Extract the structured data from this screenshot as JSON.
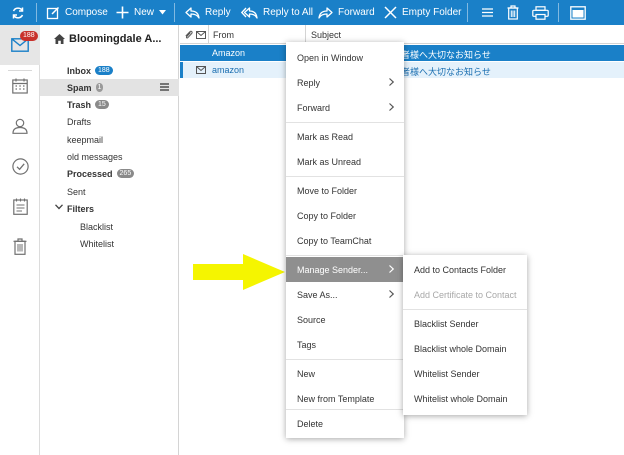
{
  "toolbar": {
    "compose": "Compose",
    "new": "New",
    "reply": "Reply",
    "reply_all": "Reply to All",
    "forward": "Forward",
    "empty_folder": "Empty Folder"
  },
  "rail": {
    "mail_badge": "188"
  },
  "folders": {
    "account": "Bloomingdale A...",
    "items": [
      {
        "name": "Inbox",
        "badge": "188"
      },
      {
        "name": "Spam",
        "badge": "1"
      },
      {
        "name": "Trash",
        "badge": "15"
      },
      {
        "name": "Drafts"
      },
      {
        "name": "keepmail"
      },
      {
        "name": "old messages"
      },
      {
        "name": "Processed",
        "badge": "265"
      },
      {
        "name": "Sent"
      },
      {
        "name": "Filters"
      },
      {
        "name": "Blacklist"
      },
      {
        "name": "Whitelist"
      }
    ]
  },
  "list": {
    "columns": {
      "from": "From",
      "subject": "Subject"
    },
    "rows": [
      {
        "from": "Amazon",
        "subject": "者様へ大切なお知らせ"
      },
      {
        "from": "amazon",
        "subject": "者様へ大切なお知らせ"
      }
    ]
  },
  "context_menu": {
    "items": [
      "Open in Window",
      "Reply",
      "Forward",
      "Mark as Read",
      "Mark as Unread",
      "Move to Folder",
      "Copy to Folder",
      "Copy to TeamChat",
      "Manage Sender...",
      "Save As...",
      "Source",
      "Tags",
      "New",
      "New from Template",
      "Delete"
    ]
  },
  "submenu": {
    "items": [
      "Add to Contacts Folder",
      "Add Certificate to Contact",
      "Blacklist Sender",
      "Blacklist whole Domain",
      "Whitelist Sender",
      "Whitelist whole Domain"
    ]
  },
  "colors": {
    "accent": "#1a80c8",
    "badge_red": "#c8312b",
    "menu_highlight": "#8f8f8f",
    "pointer": "#f5f500"
  }
}
